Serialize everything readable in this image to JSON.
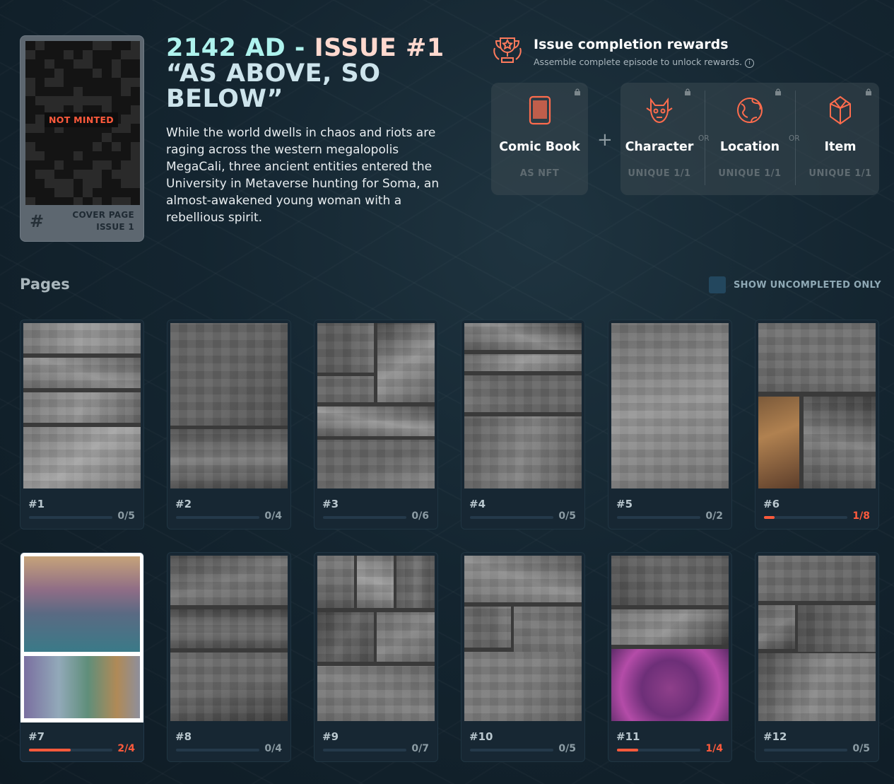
{
  "cover": {
    "badge": "NOT MINTED",
    "hash": "#",
    "label_line1": "COVER PAGE",
    "label_line2": "ISSUE 1"
  },
  "title": {
    "part1": "2142 AD - ",
    "part2": "ISSUE #1",
    "part3": "“AS ABOVE, SO BELOW”"
  },
  "description": "While the world dwells in chaos and riots are raging across the western megalopolis MegaCali, three ancient entities entered the University in Metaverse hunting for Soma, an almost-awakened young woman with a rebellious spirit.",
  "rewards": {
    "title": "Issue completion rewards",
    "subtitle": "Assemble complete episode to unlock rewards.",
    "info_icon": "i",
    "plus": "+",
    "or": "OR",
    "items": [
      {
        "name": "Comic Book",
        "sub": "AS NFT",
        "icon": "tablet-icon"
      },
      {
        "name": "Character",
        "sub": "UNIQUE 1/1",
        "icon": "character-icon"
      },
      {
        "name": "Location",
        "sub": "UNIQUE 1/1",
        "icon": "globe-icon"
      },
      {
        "name": "Item",
        "sub": "UNIQUE 1/1",
        "icon": "gem-icon"
      }
    ]
  },
  "pages": {
    "title": "Pages",
    "toggle_label": "SHOW UNCOMPLETED ONLY",
    "items": [
      {
        "num": "#1",
        "count": "0/5",
        "progress": 0
      },
      {
        "num": "#2",
        "count": "0/4",
        "progress": 0
      },
      {
        "num": "#3",
        "count": "0/6",
        "progress": 0
      },
      {
        "num": "#4",
        "count": "0/5",
        "progress": 0
      },
      {
        "num": "#5",
        "count": "0/2",
        "progress": 0
      },
      {
        "num": "#6",
        "count": "1/8",
        "progress": 0.125
      },
      {
        "num": "#7",
        "count": "2/4",
        "progress": 0.5
      },
      {
        "num": "#8",
        "count": "0/4",
        "progress": 0
      },
      {
        "num": "#9",
        "count": "0/7",
        "progress": 0
      },
      {
        "num": "#10",
        "count": "0/5",
        "progress": 0
      },
      {
        "num": "#11",
        "count": "1/4",
        "progress": 0.25
      },
      {
        "num": "#12",
        "count": "0/5",
        "progress": 0
      }
    ]
  },
  "colors": {
    "accent": "#ff5a3c",
    "title_cyan": "#aef3ee",
    "background": "#142530"
  }
}
